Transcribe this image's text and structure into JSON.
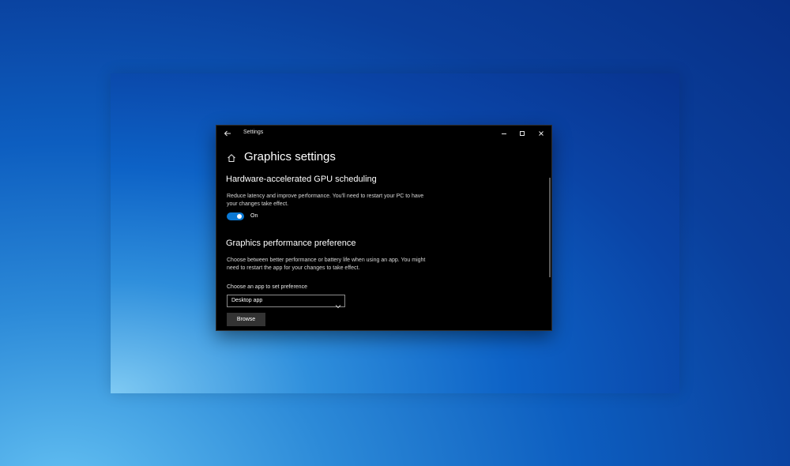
{
  "window": {
    "title": "Settings"
  },
  "page": {
    "title": "Graphics settings"
  },
  "gpu_scheduling": {
    "heading": "Hardware-accelerated GPU scheduling",
    "description": "Reduce latency and improve performance. You'll need to restart your PC to have your changes take effect.",
    "toggle_state_label": "On",
    "toggle_on": true
  },
  "performance_preference": {
    "heading": "Graphics performance preference",
    "description": "Choose between better performance or battery life when using an app. You might need to restart the app for your changes to take effect.",
    "select_label": "Choose an app to set preference",
    "select_value": "Desktop app",
    "browse_label": "Browse"
  },
  "icons": {
    "back": "back-arrow-icon",
    "minimize": "minimize-icon",
    "maximize": "maximize-icon",
    "close": "close-icon",
    "home": "home-icon",
    "dropdown": "chevron-down-icon"
  },
  "colors": {
    "accent": "#0a78d4",
    "window_bg": "#000000",
    "button_bg": "#333333"
  }
}
